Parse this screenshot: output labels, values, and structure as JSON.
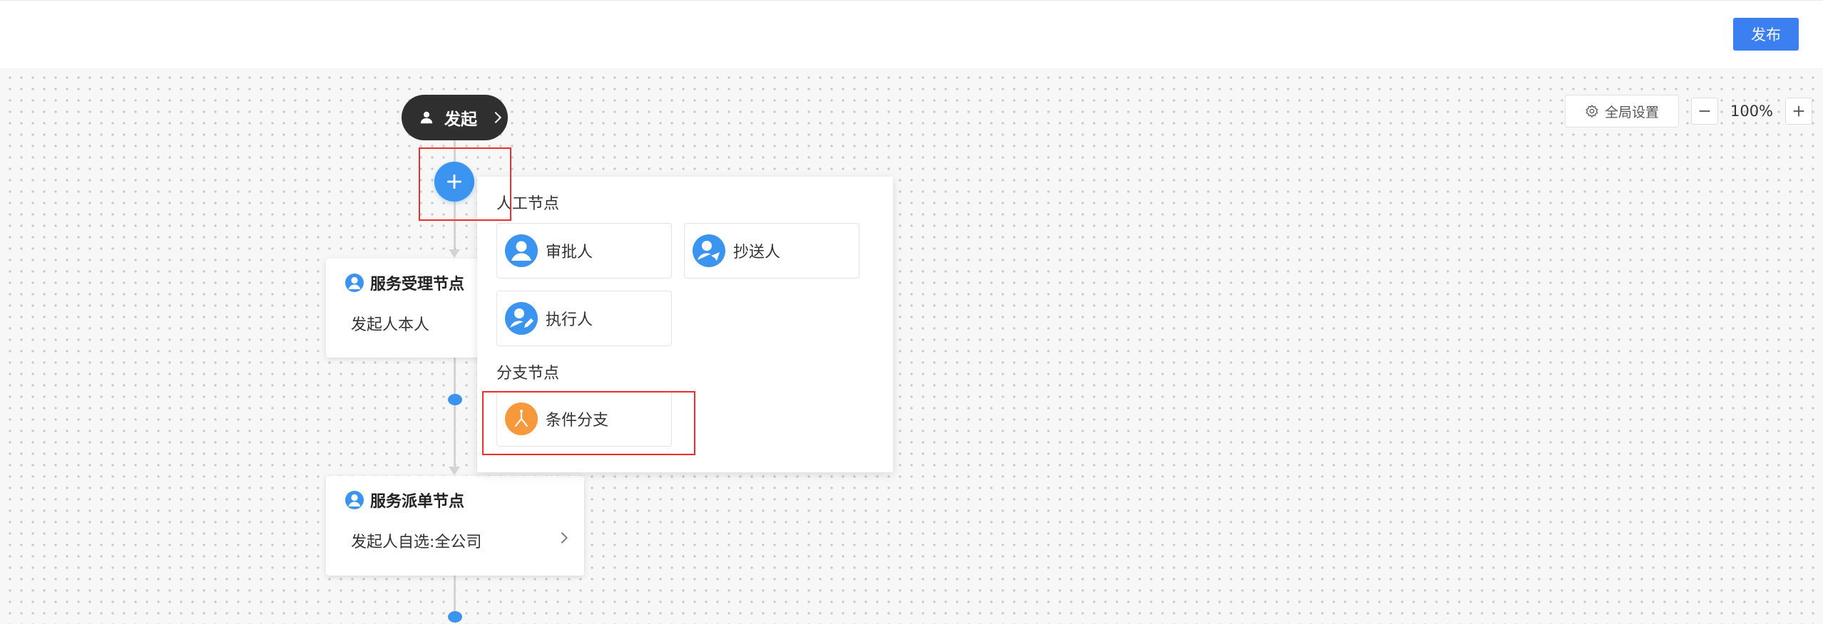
{
  "topbar": {
    "publish_label": "发布"
  },
  "toolbar": {
    "global_settings_label": "全局设置",
    "zoom_level": "100%"
  },
  "flow": {
    "start": {
      "label": "发起"
    },
    "nodes": [
      {
        "title": "服务受理节点",
        "value": "发起人本人"
      },
      {
        "title": "服务派单节点",
        "value": "发起人自选:全公司"
      }
    ]
  },
  "add_menu": {
    "manual_section_title": "人工节点",
    "manual_items": [
      {
        "label": "审批人",
        "icon": "approver-icon"
      },
      {
        "label": "抄送人",
        "icon": "cc-icon"
      },
      {
        "label": "执行人",
        "icon": "executor-icon"
      }
    ],
    "branch_section_title": "分支节点",
    "branch_items": [
      {
        "label": "条件分支",
        "icon": "condition-branch-icon"
      }
    ]
  },
  "colors": {
    "primary": "#3b7ff0",
    "node_blue": "#3a94f0",
    "branch_orange": "#f7983a",
    "start_dark": "#2f2f2f",
    "highlight_red": "#e8312f"
  }
}
